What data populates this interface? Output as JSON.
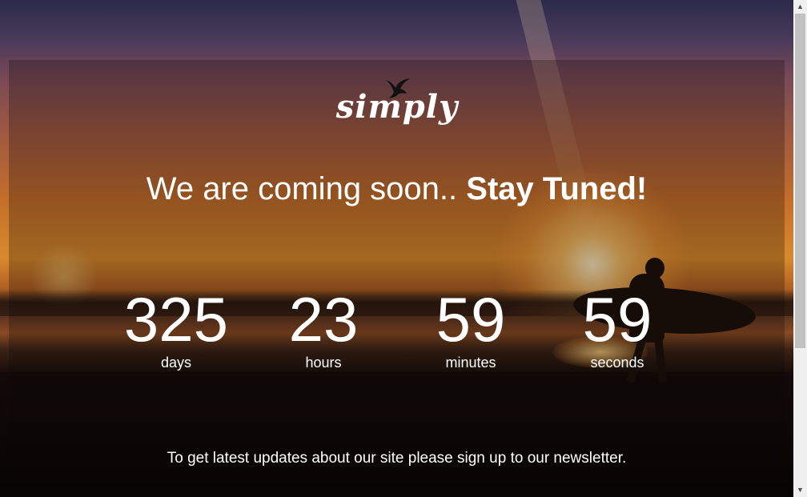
{
  "brand": {
    "logo_text": "simply",
    "logo_icon": "bird-icon"
  },
  "headline": {
    "light": "We are coming soon..",
    "bold": "Stay Tuned!"
  },
  "countdown": [
    {
      "value": "325",
      "label": "days"
    },
    {
      "value": "23",
      "label": "hours"
    },
    {
      "value": "59",
      "label": "minutes"
    },
    {
      "value": "59",
      "label": "seconds"
    }
  ],
  "newsletter": {
    "text": "To get latest updates about our site please sign up to our newsletter."
  },
  "scrollbar": {
    "up_icon": "▲",
    "down_icon": "▼"
  },
  "colors": {
    "text": "#ffffff",
    "scrollbar_bg": "#f0f0f0",
    "scrollbar_thumb": "#c1c1c1"
  }
}
